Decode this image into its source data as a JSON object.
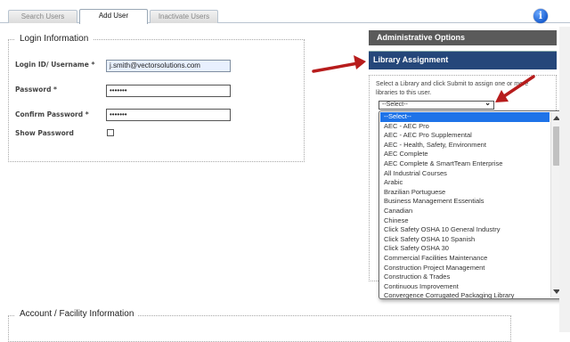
{
  "tabs": [
    {
      "label": "Search Users",
      "active": false
    },
    {
      "label": "Add User",
      "active": true
    },
    {
      "label": "Inactivate Users",
      "active": false
    }
  ],
  "info_icon": {
    "icon": "info-icon",
    "glyph": "i"
  },
  "login": {
    "legend": "Login Information",
    "login_id_label": "Login ID/ Username *",
    "login_id_value": "j.smith@vectorsolutions.com",
    "password_label": "Password *",
    "password_value": "•••••••",
    "confirm_label": "Confirm Password *",
    "confirm_value": "•••••••",
    "show_password_label": "Show Password",
    "show_password_checked": false
  },
  "account": {
    "legend": "Account / Facility Information"
  },
  "admin_options": {
    "title": "Administrative Options"
  },
  "library": {
    "title": "Library Assignment",
    "instructions": "Select a Library and click Submit to assign one or more libraries to this user.",
    "select_value": "--Select--",
    "options": [
      "--Select--",
      "AEC - AEC Pro",
      "AEC - AEC Pro Supplemental",
      "AEC - Health, Safety, Environment",
      "AEC Complete",
      "AEC Complete & SmartTeam Enterprise",
      "All Industrial Courses",
      "Arabic",
      "Brazilian Portuguese",
      "Business Management Essentials",
      "Canadian",
      "Chinese",
      "Click Safety OSHA 10 General Industry",
      "Click Safety OSHA 10 Spanish",
      "Click Safety OSHA 30",
      "Commercial Facilities Maintenance",
      "Construction Project Management",
      "Construction  & Trades",
      "Continuous Improvement",
      "Convergence Corrugated Packaging Library"
    ],
    "selected_index": 0
  },
  "colors": {
    "accent_arrow": "#b71c1c",
    "library_header": "#25477a",
    "admin_header": "#5a5a5a",
    "selected_option": "#1e73e8"
  }
}
